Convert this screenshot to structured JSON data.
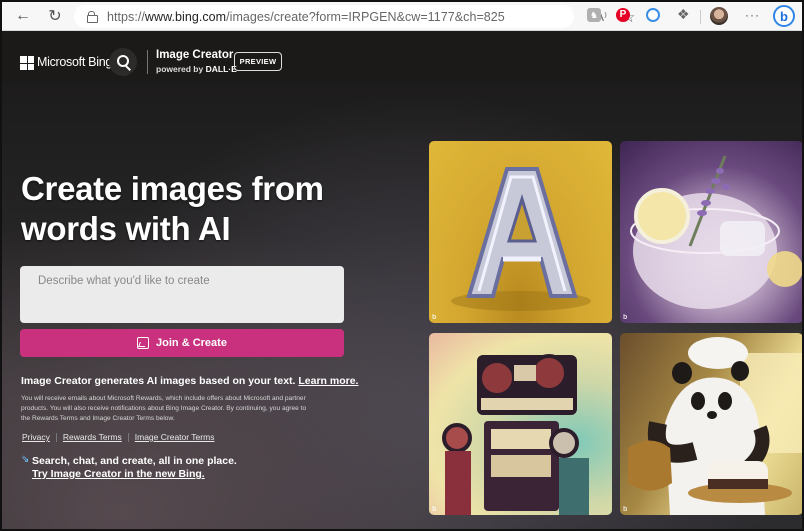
{
  "browser": {
    "url_scheme": "https://",
    "url_host": "www.bing.com",
    "url_path": "/images/create?form=IRPGEN&cw=1177&ch=825",
    "read_aloud_icon": "A⁾",
    "favorite_icon": "☆",
    "ext_gray_glyph": "♞",
    "ext_pinterest_glyph": "P",
    "puzzle_icon": "❖",
    "more_glyph": "···",
    "bing_chat_glyph": "b",
    "back_glyph": "←",
    "reload_glyph": "↻"
  },
  "header": {
    "brand": "Microsoft Bing",
    "product_title": "Image Creator",
    "powered_by_prefix": "powered by ",
    "powered_by_name": "DALL·E",
    "badge": "PREVIEW"
  },
  "hero": {
    "title_line1": "Create images from",
    "title_line2": "words with AI",
    "input_placeholder": "Describe what you'd like to create",
    "input_value": "",
    "button_label": "Join & Create"
  },
  "info": {
    "text": "Image Creator generates AI images based on your text. ",
    "learn_more": "Learn more.",
    "disclaimer": "You will receive emails about Microsoft Rewards, which include offers about Microsoft and partner products. You will also receive notifications about Bing Image Creator. By continuing, you agree to the Rewards Terms and Image Creator Terms below."
  },
  "footer_links": [
    {
      "label": "Privacy"
    },
    {
      "label": "Rewards Terms"
    },
    {
      "label": "Image Creator Terms"
    }
  ],
  "promo": {
    "icon": "⇘",
    "text": "Search, chat, and create, all in one place.",
    "link": "Try Image Creator in the new Bing."
  },
  "gallery": {
    "watermark": "b",
    "items": [
      {
        "subject": "chrome letter A on yellow background"
      },
      {
        "subject": "lavender cocktail with lemon slice"
      },
      {
        "subject": "retro robot made of cassette players"
      },
      {
        "subject": "panda chef decorating a cake"
      }
    ]
  },
  "colors": {
    "accent_button": "#c9317f",
    "header_bg": "#1b1a19"
  }
}
